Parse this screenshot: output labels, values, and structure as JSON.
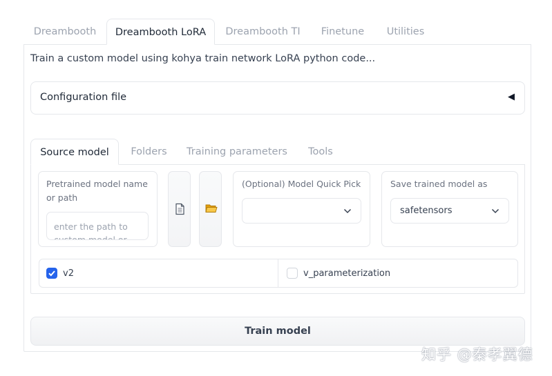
{
  "top_tabs": [
    {
      "label": "Dreambooth"
    },
    {
      "label": "Dreambooth LoRA"
    },
    {
      "label": "Dreambooth TI"
    },
    {
      "label": "Finetune"
    },
    {
      "label": "Utilities"
    }
  ],
  "active_top_tab": "Dreambooth LoRA",
  "description": "Train a custom model using kohya train network LoRA python code...",
  "config_accordion": {
    "label": "Configuration file",
    "icon": "triangle-left-icon"
  },
  "inner_tabs": [
    {
      "label": "Source model"
    },
    {
      "label": "Folders"
    },
    {
      "label": "Training parameters"
    },
    {
      "label": "Tools"
    }
  ],
  "active_inner_tab": "Source model",
  "source_model": {
    "pretrained_label": "Pretrained model name or path",
    "pretrained_value": "",
    "pretrained_placeholder": "enter the path to custom model or",
    "file_button_icon": "document-icon",
    "folder_button_icon": "folder-icon",
    "quick_pick_label": "(Optional) Model Quick Pick",
    "quick_pick_value": "",
    "save_as_label": "Save trained model as",
    "save_as_value": "safetensors",
    "v2_label": "v2",
    "v2_checked": true,
    "v_param_label": "v_parameterization",
    "v_param_checked": false
  },
  "train_button": {
    "label": "Train model"
  },
  "watermark": "知乎 @秦孝翼德",
  "colors": {
    "accent": "#2563eb",
    "border": "#e5e7eb",
    "muted_text": "#9ca3af"
  }
}
